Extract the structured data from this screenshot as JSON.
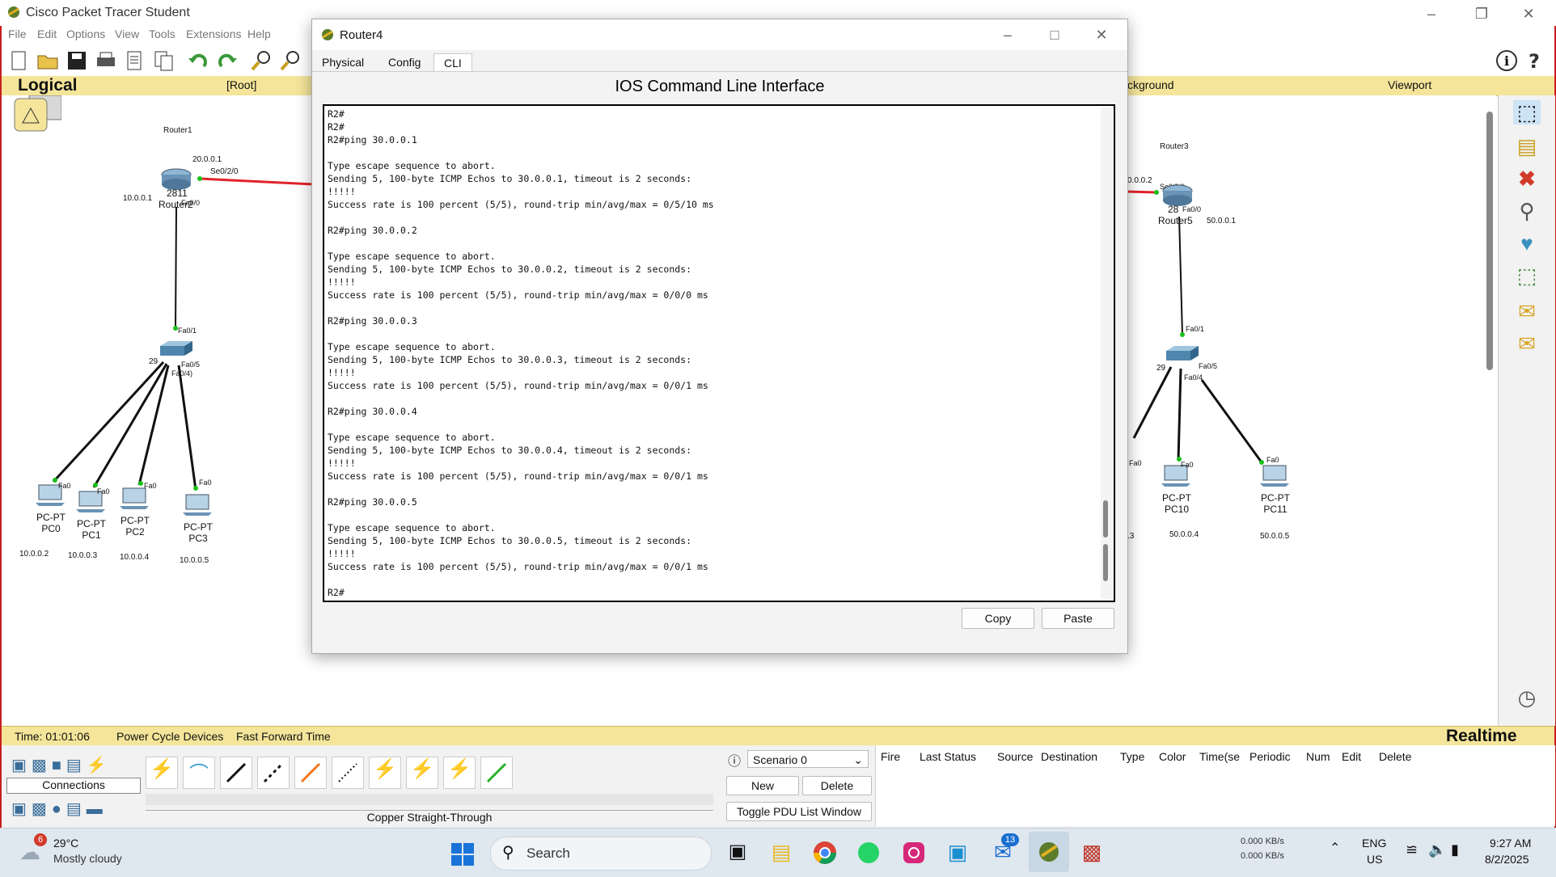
{
  "app": {
    "title": "Cisco Packet Tracer Student",
    "menu": [
      "File",
      "Edit",
      "Options",
      "View",
      "Tools",
      "Extensions",
      "Help"
    ]
  },
  "workspace": {
    "mode": "Logical",
    "root_label": "[Root]",
    "background_label": "ckground",
    "viewport_label": "Viewport"
  },
  "network": {
    "left": {
      "router1_caption": "Router1",
      "router_model": "2811",
      "router_name": "Router2",
      "ip_top": "20.0.0.1",
      "port_serial": "Se0/2/0",
      "ip_left": "10.0.0.1",
      "port_fa00": "Fa0/0",
      "switch_fa01": "Fa0/1",
      "switch_fa05": "Fa0/5",
      "switch_fa04": "Fa0/4)",
      "switch_model": "29",
      "pcs": [
        {
          "type": "PC-PT",
          "name": "PC0",
          "port": "Fa0",
          "ip": "10.0.0.2"
        },
        {
          "type": "PC-PT",
          "name": "PC1",
          "port": "Fa0",
          "ip": "10.0.0.3"
        },
        {
          "type": "PC-PT",
          "name": "PC2",
          "port": "Fa0",
          "ip": "10.0.0.4"
        },
        {
          "type": "PC-PT",
          "name": "PC3",
          "port": "Fa0",
          "ip": "10.0.0.5"
        }
      ]
    },
    "right": {
      "router3_caption": "Router3",
      "ip_serial": "0.0.0.2",
      "port_serial": "Se0/2/0",
      "router_model": "28",
      "port_fa00": "Fa0/0",
      "router_name": "Router5",
      "ip_right": "50.0.0.1",
      "switch_fa01": "Fa0/1",
      "switch_fa05": "Fa0/5",
      "switch_fa04": "Fa0/4",
      "switch_model": "29",
      "partial_port": "Fa0",
      "partial_ip": ".3",
      "pcs": [
        {
          "type": "PC-PT",
          "name": "PC10",
          "port": "Fa0",
          "ip": "50.0.0.4"
        },
        {
          "type": "PC-PT",
          "name": "PC11",
          "port": "Fa0",
          "ip": "50.0.0.5"
        }
      ]
    }
  },
  "dialog": {
    "title": "Router4",
    "tabs": [
      "Physical",
      "Config",
      "CLI"
    ],
    "active_tab": "CLI",
    "cli_heading": "IOS Command Line Interface",
    "cli_output": "R2#\nR2#\nR2#ping 30.0.0.1\n\nType escape sequence to abort.\nSending 5, 100-byte ICMP Echos to 30.0.0.1, timeout is 2 seconds:\n!!!!!\nSuccess rate is 100 percent (5/5), round-trip min/avg/max = 0/5/10 ms\n\nR2#ping 30.0.0.2\n\nType escape sequence to abort.\nSending 5, 100-byte ICMP Echos to 30.0.0.2, timeout is 2 seconds:\n!!!!!\nSuccess rate is 100 percent (5/5), round-trip min/avg/max = 0/0/0 ms\n\nR2#ping 30.0.0.3\n\nType escape sequence to abort.\nSending 5, 100-byte ICMP Echos to 30.0.0.3, timeout is 2 seconds:\n!!!!!\nSuccess rate is 100 percent (5/5), round-trip min/avg/max = 0/0/1 ms\n\nR2#ping 30.0.0.4\n\nType escape sequence to abort.\nSending 5, 100-byte ICMP Echos to 30.0.0.4, timeout is 2 seconds:\n!!!!!\nSuccess rate is 100 percent (5/5), round-trip min/avg/max = 0/0/1 ms\n\nR2#ping 30.0.0.5\n\nType escape sequence to abort.\nSending 5, 100-byte ICMP Echos to 30.0.0.5, timeout is 2 seconds:\n!!!!!\nSuccess rate is 100 percent (5/5), round-trip min/avg/max = 0/0/1 ms\n\nR2#",
    "copy_label": "Copy",
    "paste_label": "Paste"
  },
  "status": {
    "time": "Time: 01:01:06",
    "power_cycle": "Power Cycle Devices",
    "fast_forward": "Fast Forward Time",
    "mode": "Realtime"
  },
  "bottom": {
    "connections_label": "Connections",
    "cable_label": "Copper Straight-Through",
    "scenario": "Scenario 0",
    "new_label": "New",
    "delete_label": "Delete",
    "toggle_label": "Toggle PDU List Window",
    "pdu_columns": [
      "Fire",
      "Last Status",
      "Source",
      "Destination",
      "Type",
      "Color",
      "Time(se",
      "Periodic",
      "Num",
      "Edit",
      "Delete"
    ]
  },
  "taskbar": {
    "weather_temp": "29°C",
    "weather_desc": "Mostly cloudy",
    "weather_badge": "6",
    "search_placeholder": "Search",
    "outlook_badge": "13",
    "net_up": "0.000 KB/s",
    "net_down": "0.000 KB/s",
    "lang": "ENG",
    "region": "US",
    "time": "9:27 AM",
    "date": "8/2/2025"
  },
  "colors": {
    "header_yellow": "#f4e59a",
    "serial_link": "#e0232b",
    "frame_red": "#c81e1e"
  }
}
